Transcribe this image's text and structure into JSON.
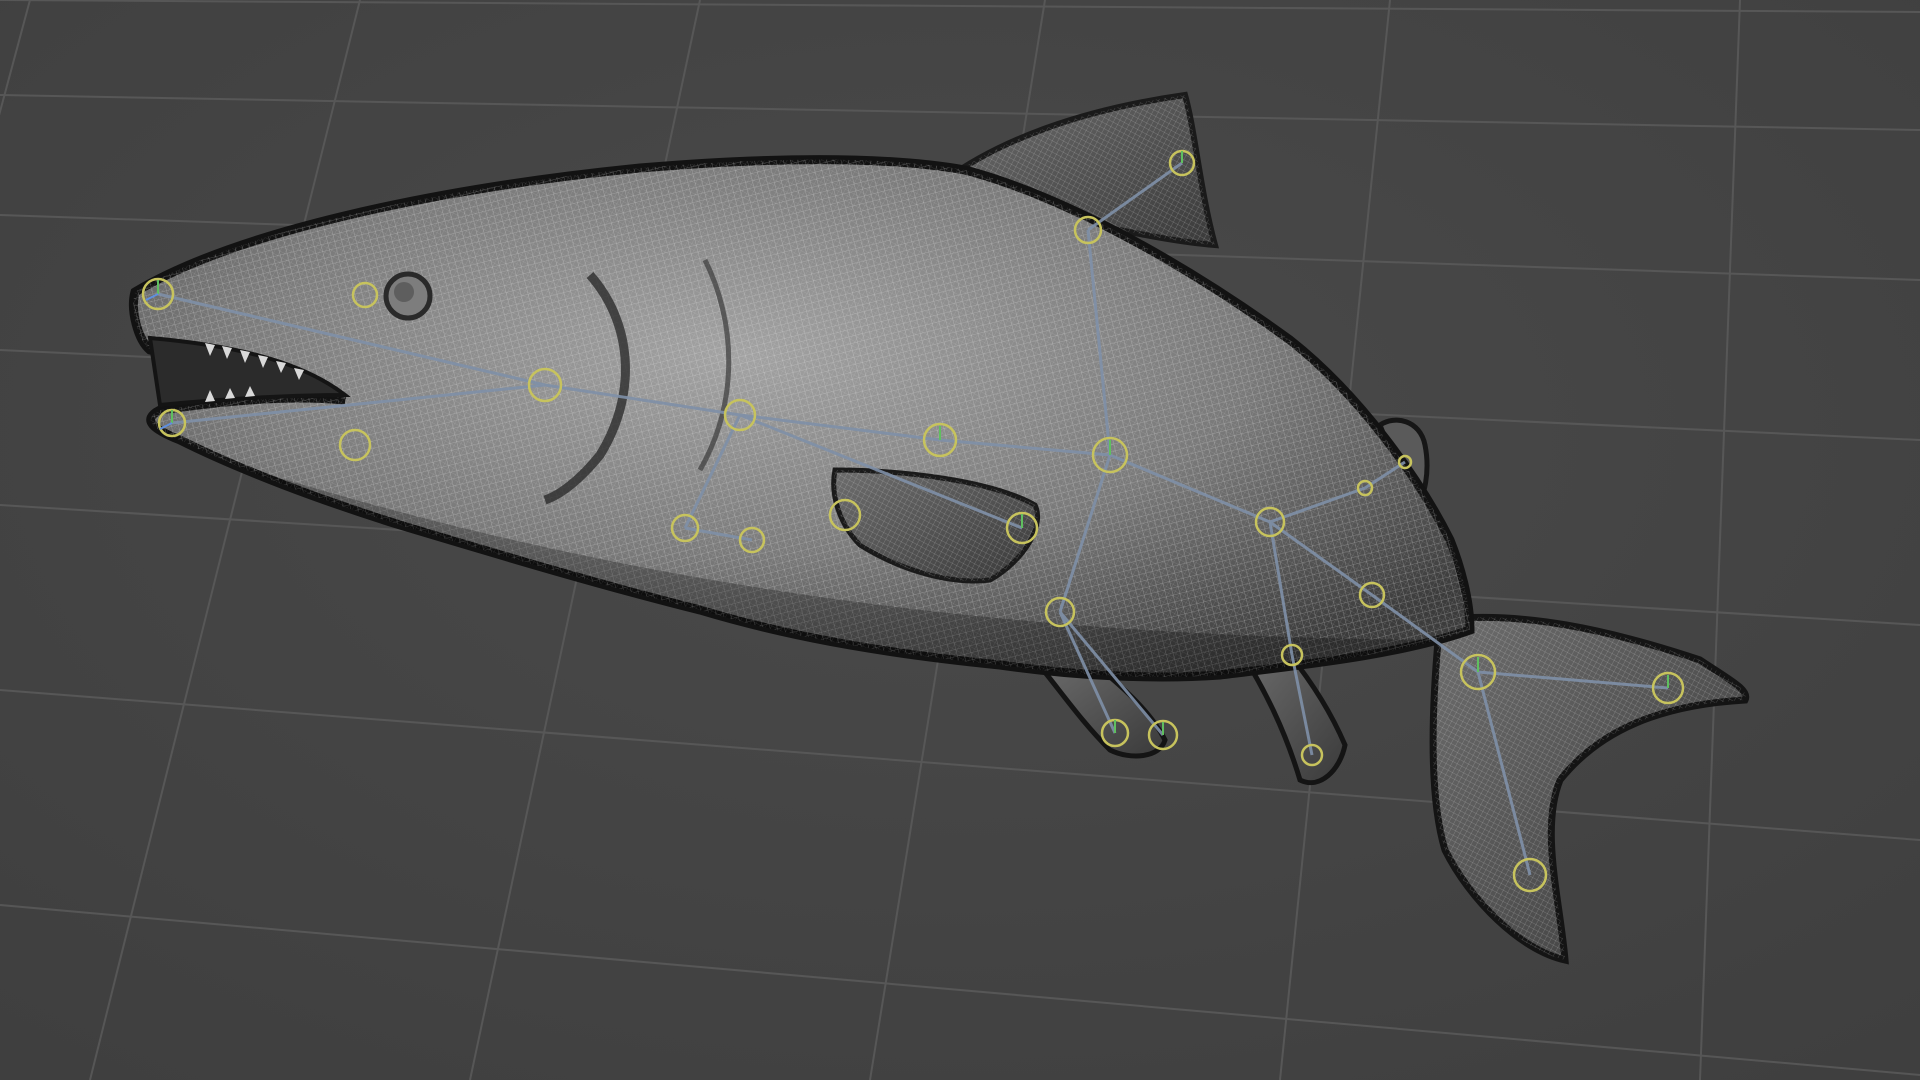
{
  "viewport": {
    "background_color": "#454545",
    "grid_color": "#5a5a5a",
    "mesh_fill_color": "#8d8d8d",
    "wire_color": "#e8e8e8",
    "bone_color": "#7a8aa0",
    "joint_color": "#c8c25a",
    "object": "fish-mesh-with-rig",
    "wireframe_on_shaded": true,
    "grid_visible": true
  }
}
